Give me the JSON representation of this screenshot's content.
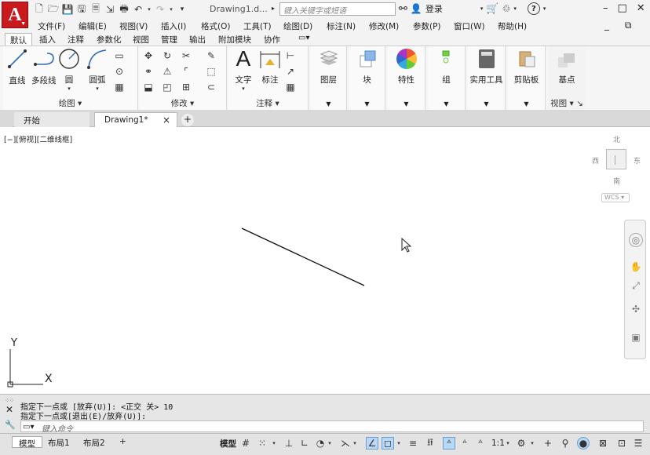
{
  "title": {
    "doc_title": "Drawing1.d...",
    "search_placeholder": "键入关键字或短语",
    "login": "登录",
    "help_symbol": "?",
    "logo_letter": "A"
  },
  "menu": [
    "文件(F)",
    "编辑(E)",
    "视图(V)",
    "插入(I)",
    "格式(O)",
    "工具(T)",
    "绘图(D)",
    "标注(N)",
    "修改(M)",
    "参数(P)",
    "窗口(W)",
    "帮助(H)"
  ],
  "ribbon_tabs": [
    "默认",
    "插入",
    "注释",
    "参数化",
    "视图",
    "管理",
    "输出",
    "附加模块",
    "协作"
  ],
  "ribbon": {
    "draw": {
      "title": "绘图",
      "line": "直线",
      "polyline": "多段线",
      "circle": "圆",
      "arc": "圆弧"
    },
    "modify": {
      "title": "修改"
    },
    "annotation": {
      "title": "注释",
      "text": "文字",
      "dimension": "标注"
    },
    "layers": "图层",
    "block": "块",
    "properties": "特性",
    "group": "组",
    "utilities": "实用工具",
    "clipboard": "剪贴板",
    "view": {
      "base": "基点",
      "title": "视图"
    }
  },
  "file_tabs": {
    "start": "开始",
    "drawing": "Drawing1*",
    "close": "×",
    "add": "+"
  },
  "viewport": {
    "label": "[−][俯视][二维线框]"
  },
  "viewcube": {
    "north": "北",
    "south": "南",
    "east": "东",
    "west": "西",
    "wcs": "WCS"
  },
  "ucs": {
    "x": "X",
    "y": "Y"
  },
  "command": {
    "line1": "指定下一点或 [放弃(U)]:  <正交 关> 10",
    "line2": "指定下一点或[退出(E)/放弃(U)]:",
    "placeholder": "键入命令"
  },
  "status": {
    "layouts": [
      "模型",
      "布局1",
      "布局2"
    ],
    "add": "+",
    "model": "模型",
    "scale": "1:1"
  },
  "colors": {
    "accent": "#c8191e",
    "ribbon_bg": "#f5f5f5",
    "active_toggle": "#b8d8f5"
  }
}
